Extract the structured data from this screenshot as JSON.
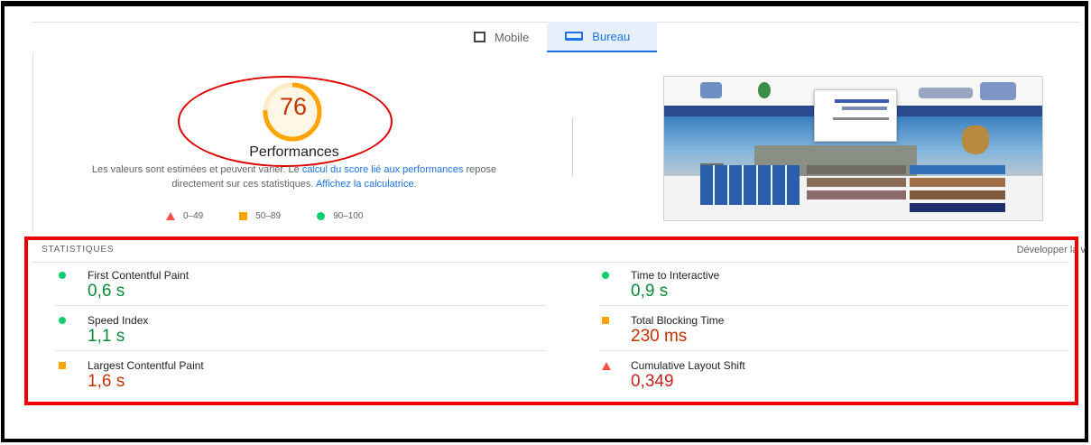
{
  "tabs": [
    {
      "label": "Mobile",
      "icon": "mobile-icon",
      "active": false
    },
    {
      "label": "Bureau",
      "icon": "desktop-icon",
      "active": true
    }
  ],
  "score": {
    "value": "76",
    "label": "Performances",
    "fraction": 0.76,
    "color": "#ffa400"
  },
  "description": {
    "part1": "Les valeurs sont estimées et peuvent varier. Le ",
    "link1": "calcul du score lié aux performances",
    "part2": " repose directement sur ces statistiques. ",
    "link2": "Affichez la calculatrice",
    "part3": "."
  },
  "legend": [
    {
      "shape": "triangle",
      "label": "0–49",
      "color": "#ff4e42"
    },
    {
      "shape": "square",
      "label": "50–89",
      "color": "#ffa400"
    },
    {
      "shape": "circle",
      "label": "90–100",
      "color": "#0cce6b"
    }
  ],
  "stats": {
    "heading": "STATISTIQUES",
    "expand_label": "Développer la v",
    "metrics": [
      {
        "name": "First Contentful Paint",
        "value": "0,6 s",
        "rating": "good"
      },
      {
        "name": "Time to Interactive",
        "value": "0,9 s",
        "rating": "good"
      },
      {
        "name": "Speed Index",
        "value": "1,1 s",
        "rating": "good"
      },
      {
        "name": "Total Blocking Time",
        "value": "230 ms",
        "rating": "average"
      },
      {
        "name": "Largest Contentful Paint",
        "value": "1,6 s",
        "rating": "average"
      },
      {
        "name": "Cumulative Layout Shift",
        "value": "0,349",
        "rating": "poor"
      }
    ]
  }
}
